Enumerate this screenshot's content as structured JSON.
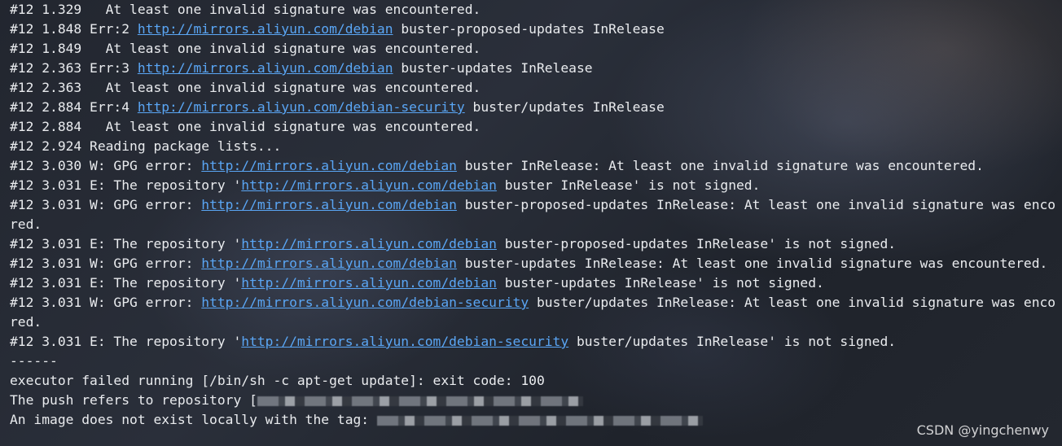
{
  "terminal": {
    "lines": [
      {
        "pre": "#12 1.329   At least one invalid signature was encountered.",
        "link": "",
        "post": ""
      },
      {
        "pre": "#12 1.848 Err:2 ",
        "link": "http://mirrors.aliyun.com/debian",
        "post": " buster-proposed-updates InRelease"
      },
      {
        "pre": "#12 1.849   At least one invalid signature was encountered.",
        "link": "",
        "post": ""
      },
      {
        "pre": "#12 2.363 Err:3 ",
        "link": "http://mirrors.aliyun.com/debian",
        "post": " buster-updates InRelease"
      },
      {
        "pre": "#12 2.363   At least one invalid signature was encountered.",
        "link": "",
        "post": ""
      },
      {
        "pre": "#12 2.884 Err:4 ",
        "link": "http://mirrors.aliyun.com/debian-security",
        "post": " buster/updates InRelease"
      },
      {
        "pre": "#12 2.884   At least one invalid signature was encountered.",
        "link": "",
        "post": ""
      },
      {
        "pre": "#12 2.924 Reading package lists...",
        "link": "",
        "post": ""
      },
      {
        "pre": "#12 3.030 W: GPG error: ",
        "link": "http://mirrors.aliyun.com/debian",
        "post": " buster InRelease: At least one invalid signature was encountered."
      },
      {
        "pre": "#12 3.031 E: The repository '",
        "link": "http://mirrors.aliyun.com/debian",
        "post": " buster InRelease' is not signed."
      },
      {
        "pre": "#12 3.031 W: GPG error: ",
        "link": "http://mirrors.aliyun.com/debian",
        "post": " buster-proposed-updates InRelease: At least one invalid signature was enco"
      },
      {
        "pre": "red.",
        "link": "",
        "post": ""
      },
      {
        "pre": "#12 3.031 E: The repository '",
        "link": "http://mirrors.aliyun.com/debian",
        "post": " buster-proposed-updates InRelease' is not signed."
      },
      {
        "pre": "#12 3.031 W: GPG error: ",
        "link": "http://mirrors.aliyun.com/debian",
        "post": " buster-updates InRelease: At least one invalid signature was encountered."
      },
      {
        "pre": "#12 3.031 E: The repository '",
        "link": "http://mirrors.aliyun.com/debian",
        "post": " buster-updates InRelease' is not signed."
      },
      {
        "pre": "#12 3.031 W: GPG error: ",
        "link": "http://mirrors.aliyun.com/debian-security",
        "post": " buster/updates InRelease: At least one invalid signature was enco"
      },
      {
        "pre": "red.",
        "link": "",
        "post": ""
      },
      {
        "pre": "#12 3.031 E: The repository '",
        "link": "http://mirrors.aliyun.com/debian-security",
        "post": " buster/updates InRelease' is not signed."
      },
      {
        "pre": "------",
        "link": "",
        "post": ""
      },
      {
        "pre": "executor failed running [/bin/sh -c apt-get update]: exit code: 100",
        "link": "",
        "post": ""
      },
      {
        "pre": "The push refers to repository [",
        "link": "",
        "post": ""
      },
      {
        "pre": "An image does not exist locally with the tag: ",
        "link": "",
        "post": ""
      }
    ]
  },
  "watermark": "CSDN @yingchenwy"
}
